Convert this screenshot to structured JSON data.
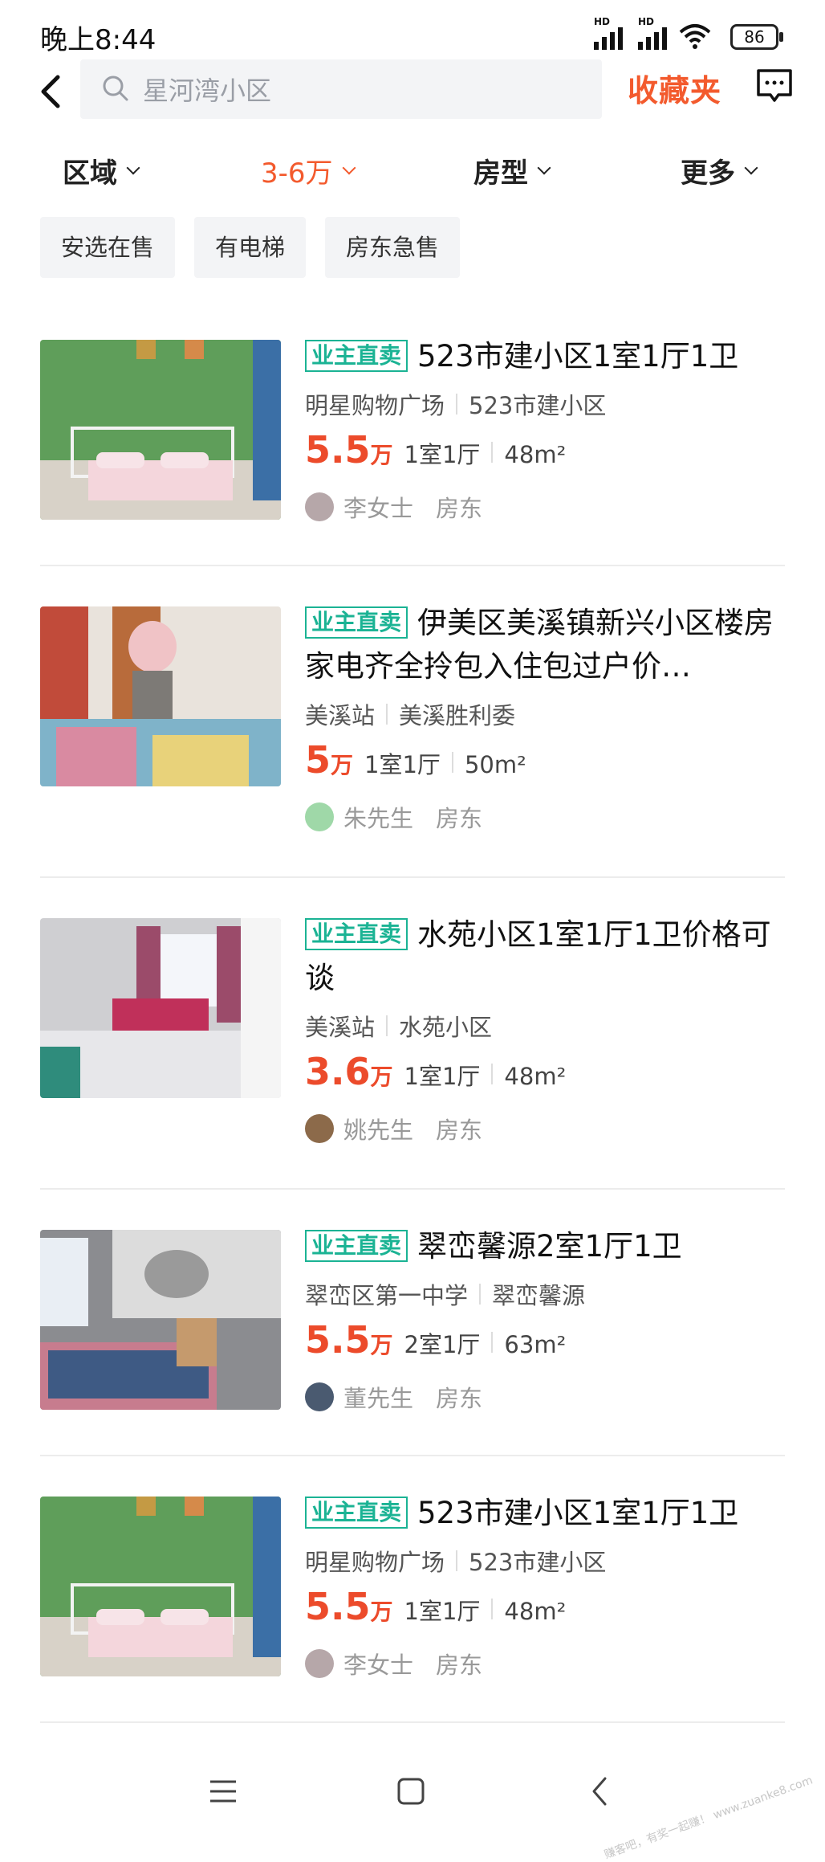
{
  "status": {
    "time": "晚上8:44",
    "hd1": "HD",
    "hd2": "HD",
    "battery": "86"
  },
  "search": {
    "placeholder": "星河湾小区"
  },
  "header": {
    "favorites": "收藏夹"
  },
  "filters": [
    {
      "label": "区域",
      "active": false
    },
    {
      "label": "3-6万",
      "active": true
    },
    {
      "label": "房型",
      "active": false
    },
    {
      "label": "更多",
      "active": false
    }
  ],
  "tags": [
    "安选在售",
    "有电梯",
    "房东急售"
  ],
  "listings": [
    {
      "badge": "业主直卖",
      "title": "523市建小区1室1厅1卫",
      "area": "明星购物广场",
      "community": "523市建小区",
      "price": "5.5",
      "unit": "万",
      "layout": "1室1厅",
      "size": "48m²",
      "owner": "李女士",
      "role": "房东"
    },
    {
      "badge": "业主直卖",
      "title": "伊美区美溪镇新兴小区楼房家电齐全拎包入住包过户价…",
      "area": "美溪站",
      "community": "美溪胜利委",
      "price": "5",
      "unit": "万",
      "layout": "1室1厅",
      "size": "50m²",
      "owner": "朱先生",
      "role": "房东"
    },
    {
      "badge": "业主直卖",
      "title": "水苑小区1室1厅1卫价格可谈",
      "area": "美溪站",
      "community": "水苑小区",
      "price": "3.6",
      "unit": "万",
      "layout": "1室1厅",
      "size": "48m²",
      "owner": "姚先生",
      "role": "房东"
    },
    {
      "badge": "业主直卖",
      "title": "翠峦馨源2室1厅1卫",
      "area": "翠峦区第一中学",
      "community": "翠峦馨源",
      "price": "5.5",
      "unit": "万",
      "layout": "2室1厅",
      "size": "63m²",
      "owner": "董先生",
      "role": "房东"
    },
    {
      "badge": "业主直卖",
      "title": "523市建小区1室1厅1卫",
      "area": "明星购物广场",
      "community": "523市建小区",
      "price": "5.5",
      "unit": "万",
      "layout": "1室1厅",
      "size": "48m²",
      "owner": "李女士",
      "role": "房东"
    }
  ],
  "watermark": "赚客吧，有奖一起赚！ www.zuanke8.com",
  "colors": {
    "accent": "#f35a2d",
    "price": "#ec4b2b",
    "badge": "#1bb394"
  },
  "icons": [
    "back-arrow-icon",
    "search-icon",
    "message-icon",
    "menu-icon",
    "home-icon",
    "nav-back-icon"
  ]
}
